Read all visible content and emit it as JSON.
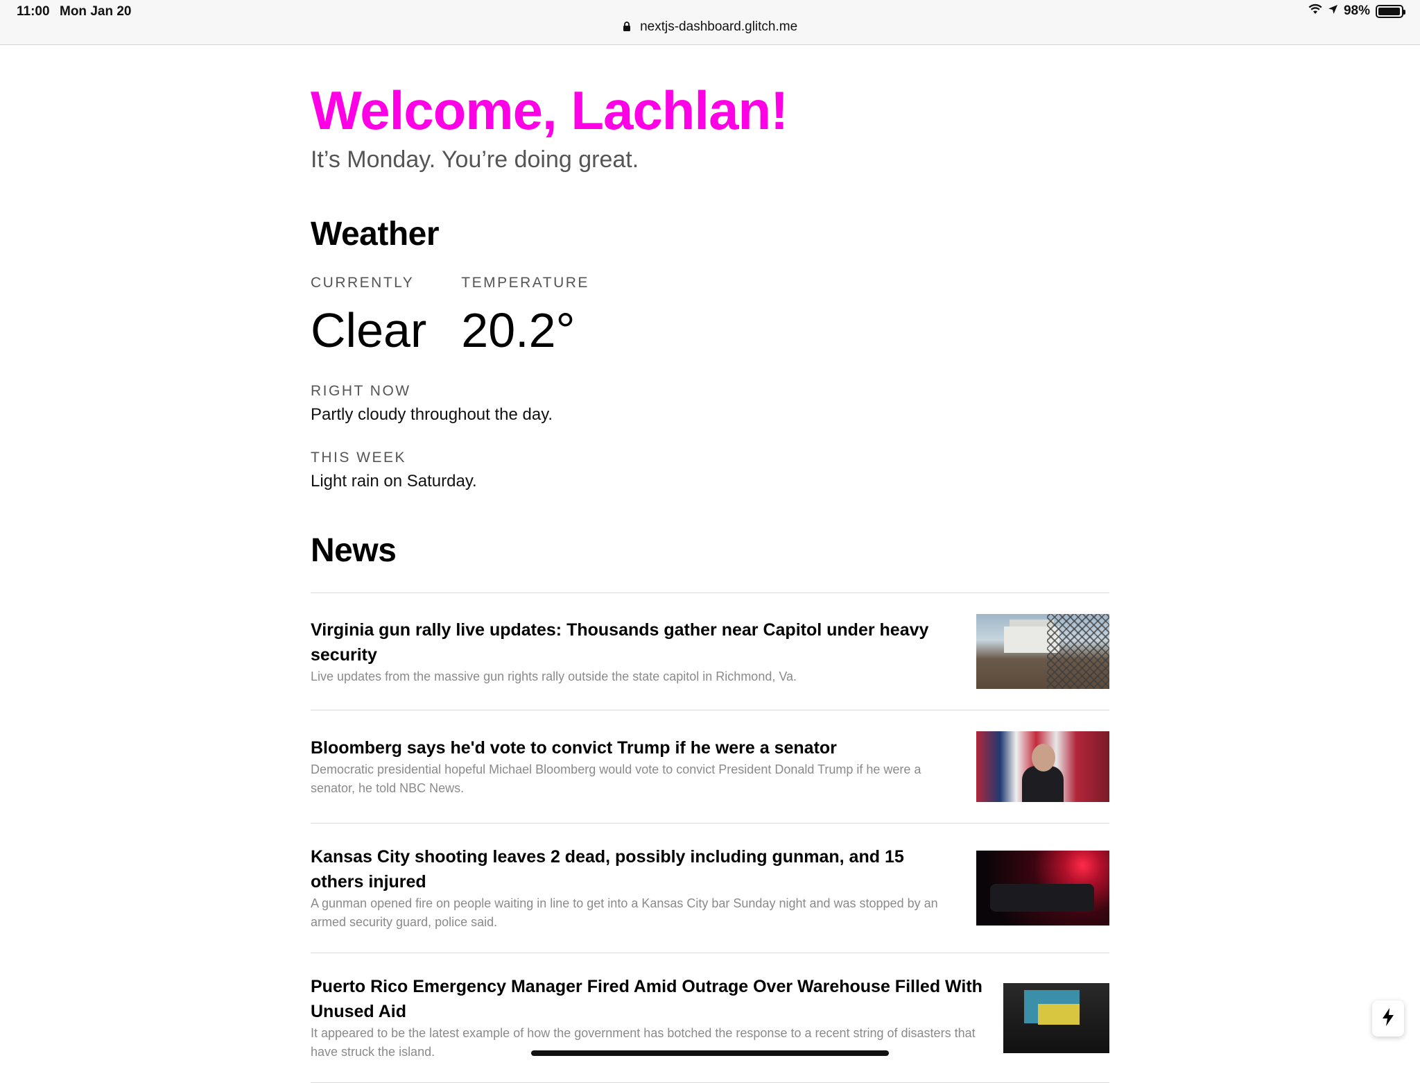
{
  "status_bar": {
    "time": "11:00",
    "date": "Mon Jan 20",
    "battery": "98%",
    "battery_level": 0.98
  },
  "browser": {
    "url": "nextjs-dashboard.glitch.me"
  },
  "page": {
    "greeting": "Welcome, Lachlan!",
    "subtitle": "It’s Monday. You’re doing great.",
    "accent_color": "#ff00e6"
  },
  "weather": {
    "heading": "Weather",
    "currently_label": "Currently",
    "currently_value": "Clear",
    "temperature_label": "Temperature",
    "temperature_value": "20.2°",
    "right_now_label": "Right now",
    "right_now_text": "Partly cloudy throughout the day.",
    "this_week_label": "This week",
    "this_week_text": "Light rain on Saturday."
  },
  "news": {
    "heading": "News",
    "items": [
      {
        "title": "Virginia gun rally live updates: Thousands gather near Capitol under heavy security",
        "description": "Live updates from the massive gun rights rally outside the state capitol in Richmond, Va.",
        "thumbnail": "capitol-photo"
      },
      {
        "title": "Bloomberg says he'd vote to convict Trump if he were a senator",
        "description": "Democratic presidential hopeful Michael Bloomberg would vote to convict President Donald Trump if he were a senator, he told NBC News.",
        "thumbnail": "bloomberg-photo"
      },
      {
        "title": "Kansas City shooting leaves 2 dead, possibly including gunman, and 15 others injured",
        "description": "A gunman opened fire on people waiting in line to get into a Kansas City bar Sunday night and was stopped by an armed security guard, police said.",
        "thumbnail": "police-car-photo"
      },
      {
        "title": "Puerto Rico Emergency Manager Fired Amid Outrage Over Warehouse Filled With Unused Aid",
        "description": "It appeared to be the latest example of how the government has botched the response to a recent string of disasters that have struck the island.",
        "thumbnail": "warehouse-aid-photo"
      }
    ]
  },
  "icons": {
    "lock": "lock-icon",
    "wifi": "wifi-icon",
    "location": "location-arrow-icon",
    "battery": "battery-icon",
    "fab": "lightning-bolt-icon"
  }
}
